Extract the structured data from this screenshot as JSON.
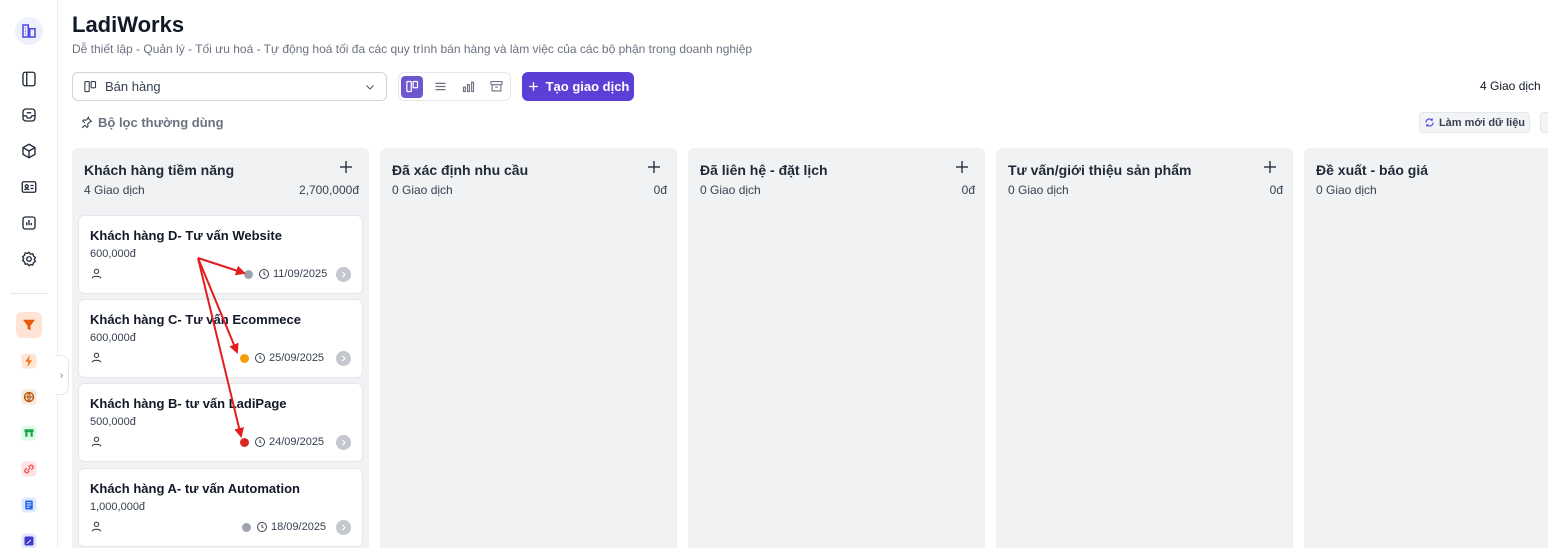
{
  "app": {
    "title": "LadiWorks",
    "subtitle": "Dễ thiết lập - Quản lý - Tối ưu hoá - Tự động hoá tối đa các quy trình bán hàng và làm việc của các bộ phận trong doanh nghiệp"
  },
  "sidebar": {
    "icons": [
      "building-icon",
      "notebook-icon",
      "inbox-icon",
      "box-icon",
      "contact-card-icon",
      "chart-icon",
      "settings-icon",
      "funnel-icon",
      "lightning-icon",
      "globe-icon",
      "store-icon",
      "link-icon",
      "document-icon",
      "edit-icon"
    ],
    "colors": {
      "active": "#ea580c",
      "lightning": "#f97316",
      "globe": "#b45309",
      "store": "#16a34a",
      "link": "#ef4444",
      "document": "#2563eb",
      "edit": "#4338ca"
    }
  },
  "toolbar": {
    "pipeline_value": "Bán hàng",
    "create_label": "Tạo giao dịch",
    "deal_count": "4 Giao dịch",
    "filter_label": "Bộ lọc thường dùng",
    "refresh_label": "Làm mới dữ liệu"
  },
  "colors": {
    "accent": "#5b3fd6",
    "dot_gray": "#9ca3af",
    "dot_orange": "#f59e0b",
    "dot_red": "#dc2626",
    "annotation": "#e11d1d"
  },
  "columns": [
    {
      "title": "Khách hàng tiềm năng",
      "count": "4 Giao dịch",
      "total": "2,700,000đ",
      "cards": [
        {
          "title": "Khách hàng D- Tư vấn Website",
          "amount": "600,000đ",
          "date": "11/09/2025",
          "status": "gray"
        },
        {
          "title": "Khách hàng C- Tư vấn Ecommece",
          "amount": "600,000đ",
          "date": "25/09/2025",
          "status": "orange"
        },
        {
          "title": "Khách hàng B- tư vấn LadiPage",
          "amount": "500,000đ",
          "date": "24/09/2025",
          "status": "red"
        },
        {
          "title": "Khách hàng A- tư vấn Automation",
          "amount": "1,000,000đ",
          "date": "18/09/2025",
          "status": "gray"
        }
      ]
    },
    {
      "title": "Đã xác định nhu cầu",
      "count": "0 Giao dịch",
      "total": "0đ",
      "cards": []
    },
    {
      "title": "Đã liên hệ - đặt lịch",
      "count": "0 Giao dịch",
      "total": "0đ",
      "cards": []
    },
    {
      "title": "Tư vấn/giới thiệu sản phẩm",
      "count": "0 Giao dịch",
      "total": "0đ",
      "cards": []
    },
    {
      "title": "Đề xuất - báo giá",
      "count": "0 Giao dịch",
      "total": "",
      "cards": []
    }
  ]
}
